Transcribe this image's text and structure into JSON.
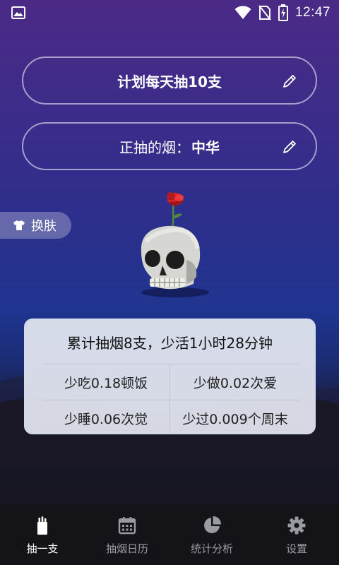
{
  "statusbar": {
    "time": "12:47"
  },
  "plan": {
    "label": "计划每天抽10支"
  },
  "brand": {
    "label": "正抽的烟：",
    "value": "中华"
  },
  "skin": {
    "label": "换肤"
  },
  "stats": {
    "headline": "累计抽烟8支，少活1小时28分钟",
    "items": [
      "少吃0.18顿饭",
      "少做0.02次爱",
      "少睡0.06次觉",
      "少过0.009个周末"
    ]
  },
  "nav": {
    "items": [
      {
        "label": "抽一支",
        "icon": "cigarette-pack-icon",
        "active": true
      },
      {
        "label": "抽烟日历",
        "icon": "calendar-icon",
        "active": false
      },
      {
        "label": "统计分析",
        "icon": "pie-chart-icon",
        "active": false
      },
      {
        "label": "设置",
        "icon": "gear-icon",
        "active": false
      }
    ]
  },
  "colors": {
    "accent": "#ffffff",
    "rose": "#e02a2a",
    "card": "#e2e6f0"
  }
}
